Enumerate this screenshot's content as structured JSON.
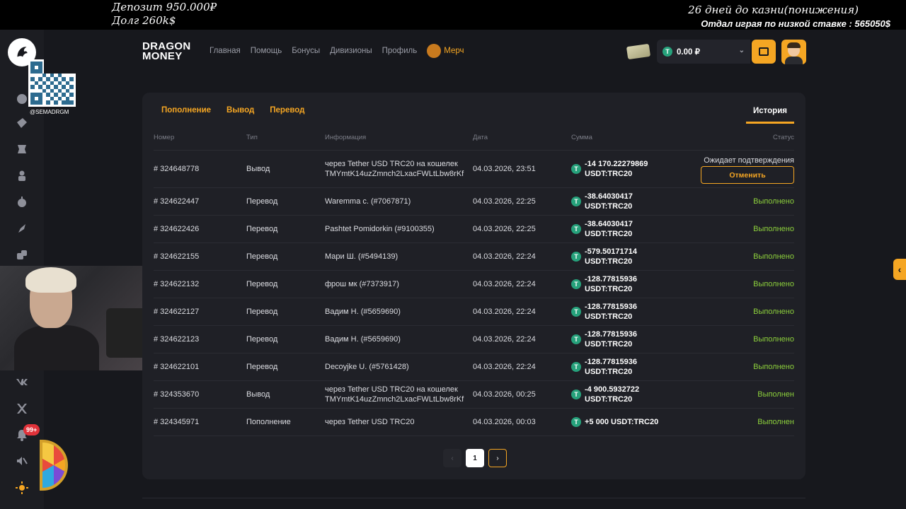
{
  "overlay": {
    "deposit": "Депозит 950.000₽",
    "debt": "Долг  260k$",
    "countdown": "26 дней до казни(понижения)",
    "note": "Отдал играя по низкой ставке : 565050$",
    "qr_caption": "@SEMADRGM"
  },
  "sidebar": {
    "notifications_badge": "99+"
  },
  "header": {
    "brand_line1": "DRAGON",
    "brand_line2": "MONEY",
    "nav": [
      "Главная",
      "Помощь",
      "Бонусы",
      "Дивизионы",
      "Профиль"
    ],
    "merch_label": "Мерч",
    "balance": "0.00 ₽",
    "currency_icon": "T"
  },
  "tabs": {
    "deposit": "Пополнение",
    "withdraw": "Вывод",
    "transfer": "Перевод",
    "history": "История"
  },
  "table": {
    "headers": {
      "number": "Номер",
      "type": "Тип",
      "info": "Информация",
      "date": "Дата",
      "sum": "Сумма",
      "status": "Статус"
    },
    "rows": [
      {
        "number": "# 324648778",
        "type": "Вывод",
        "info1": "через Tether USD TRC20 на кошелек",
        "info2": "TMYmtK14uzZmnch2LxacFWLtLbw8rKf",
        "date": "04.03.2026, 23:51",
        "amount1": "-14 170.22279869",
        "amount2": "USDT:TRC20",
        "status": "Ожидает подтверждения",
        "action": "Отменить"
      },
      {
        "number": "# 324622447",
        "type": "Перевод",
        "info1": "Waremma c. (#7067871)",
        "info2": "",
        "date": "04.03.2026, 22:25",
        "amount1": "-38.64030417",
        "amount2": "USDT:TRC20",
        "status": "Выполнено"
      },
      {
        "number": "# 324622426",
        "type": "Перевод",
        "info1": "Pashtet Pomidorkin (#9100355)",
        "info2": "",
        "date": "04.03.2026, 22:25",
        "amount1": "-38.64030417",
        "amount2": "USDT:TRC20",
        "status": "Выполнено"
      },
      {
        "number": "# 324622155",
        "type": "Перевод",
        "info1": "Мари Ш. (#5494139)",
        "info2": "",
        "date": "04.03.2026, 22:24",
        "amount1": "-579.50171714",
        "amount2": "USDT:TRC20",
        "status": "Выполнено"
      },
      {
        "number": "# 324622132",
        "type": "Перевод",
        "info1": "фрош мк (#7373917)",
        "info2": "",
        "date": "04.03.2026, 22:24",
        "amount1": "-128.77815936",
        "amount2": "USDT:TRC20",
        "status": "Выполнено"
      },
      {
        "number": "# 324622127",
        "type": "Перевод",
        "info1": "Вадим Н. (#5659690)",
        "info2": "",
        "date": "04.03.2026, 22:24",
        "amount1": "-128.77815936",
        "amount2": "USDT:TRC20",
        "status": "Выполнено"
      },
      {
        "number": "# 324622123",
        "type": "Перевод",
        "info1": "Вадим Н. (#5659690)",
        "info2": "",
        "date": "04.03.2026, 22:24",
        "amount1": "-128.77815936",
        "amount2": "USDT:TRC20",
        "status": "Выполнено"
      },
      {
        "number": "# 324622101",
        "type": "Перевод",
        "info1": "Decoyjke U. (#5761428)",
        "info2": "",
        "date": "04.03.2026, 22:24",
        "amount1": "-128.77815936",
        "amount2": "USDT:TRC20",
        "status": "Выполнено"
      },
      {
        "number": "# 324353670",
        "type": "Вывод",
        "info1": "через Tether USD TRC20 на кошелек",
        "info2": "TMYmtK14uzZmnch2LxacFWLtLbw8rKf",
        "date": "04.03.2026, 00:25",
        "amount1": "-4 900.5932722",
        "amount2": "USDT:TRC20",
        "status": "Выполнен"
      },
      {
        "number": "# 324345971",
        "type": "Пополнение",
        "info1": "через Tether USD TRC20",
        "info2": "",
        "date": "04.03.2026, 00:03",
        "amount1": "+5 000 USDT:TRC20",
        "amount2": "",
        "status": "Выполнен"
      }
    ]
  },
  "pagination": {
    "prev": "‹",
    "current": "1",
    "next": "›"
  },
  "colors": {
    "accent": "#f5a623",
    "success": "#8ccf3c",
    "tether": "#26a17b",
    "background": "#17181d",
    "panel": "#1f2026"
  }
}
